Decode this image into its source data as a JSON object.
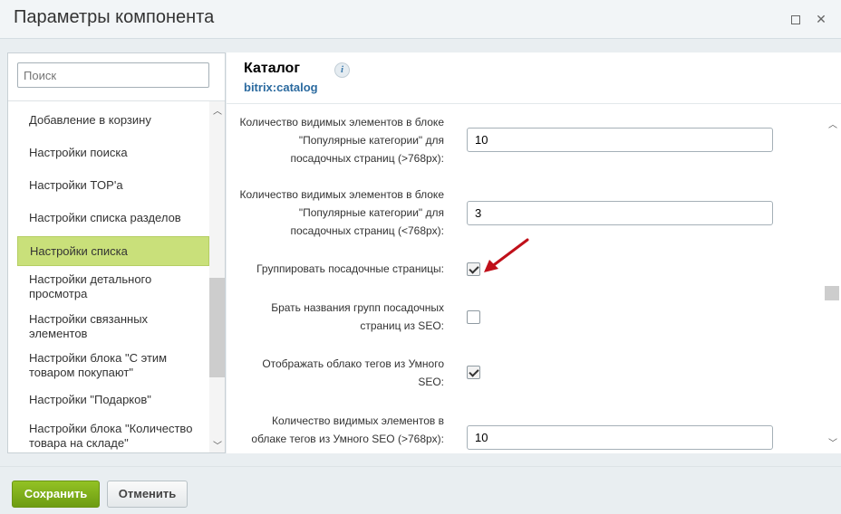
{
  "window": {
    "title": "Параметры компонента"
  },
  "sidebar": {
    "search_placeholder": "Поиск",
    "items": [
      {
        "label": "Добавление в корзину"
      },
      {
        "label": "Настройки поиска"
      },
      {
        "label": "Настройки TOP'а"
      },
      {
        "label": "Настройки списка разделов"
      },
      {
        "label": "Настройки списка",
        "active": true
      },
      {
        "label": "Настройки детального просмотра"
      },
      {
        "label": "Настройки связанных элементов"
      },
      {
        "label": "Настройки блока \"С этим товаром покупают\""
      },
      {
        "label": "Настройки \"Подарков\""
      },
      {
        "label": "Настройки блока \"Количество товара на складе\""
      }
    ]
  },
  "component": {
    "title": "Каталог",
    "code": "bitrix:catalog",
    "info_icon": "i"
  },
  "params": [
    {
      "label": "Количество видимых элементов в блоке \"Популярные категории\" для посадочных страниц (>768px):",
      "type": "text",
      "value": "10"
    },
    {
      "label": "Количество видимых элементов в блоке \"Популярные категории\" для посадочных страниц (<768px):",
      "type": "text",
      "value": "3"
    },
    {
      "label": "Группировать посадочные страницы:",
      "type": "checkbox",
      "checked": true
    },
    {
      "label": "Брать названия групп посадочных страниц из SEO:",
      "type": "checkbox",
      "checked": false
    },
    {
      "label": "Отображать облако тегов из Умного SEO:",
      "type": "checkbox",
      "checked": true
    },
    {
      "label": "Количество видимых элементов в облаке тегов из Умного SEO (>768px):",
      "type": "text",
      "value": "10"
    }
  ],
  "footer": {
    "save_label": "Сохранить",
    "cancel_label": "Отменить"
  },
  "colors": {
    "accent_green": "#7aad1a",
    "active_item": "#c9e07a",
    "annotation_arrow": "#c0101a",
    "link_blue": "#2b6a9f"
  },
  "icons": {
    "maximize": "maximize-icon",
    "close": "close-icon",
    "info": "info-icon",
    "scroll_up": "chevron-up-icon",
    "scroll_down": "chevron-down-icon",
    "annotation": "red-arrow-icon"
  }
}
